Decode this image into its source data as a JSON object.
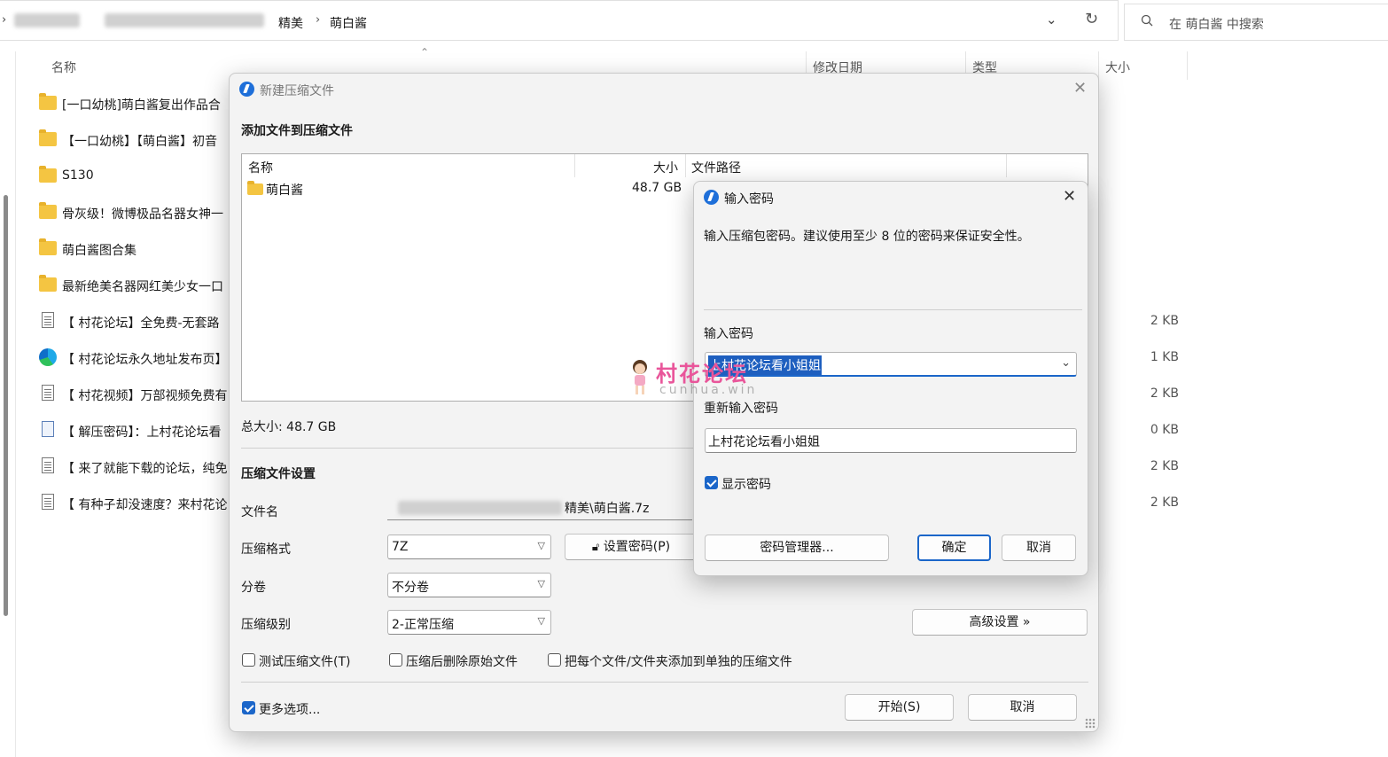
{
  "explorer": {
    "breadcrumb": [
      "精美",
      "萌白酱"
    ],
    "search_placeholder": "在 萌白酱 中搜索",
    "columns": {
      "name": "名称",
      "date": "修改日期",
      "type": "类型",
      "size": "大小"
    },
    "files": [
      {
        "icon": "folder",
        "name": "[一口幼桃]萌白酱复出作品合",
        "size": ""
      },
      {
        "icon": "folder",
        "name": "【一口幼桃】【萌白酱】初音",
        "size": ""
      },
      {
        "icon": "folder",
        "name": "S130",
        "size": ""
      },
      {
        "icon": "folder",
        "name": "骨灰级！微博极品名器女神一",
        "size": ""
      },
      {
        "icon": "folder",
        "name": "萌白酱图合集",
        "size": ""
      },
      {
        "icon": "folder",
        "name": "最新绝美名器网红美少女一口",
        "size": ""
      },
      {
        "icon": "document",
        "name": "【 村花论坛】全免费-无套路",
        "size": "2 KB"
      },
      {
        "icon": "edge",
        "name": "【 村花论坛永久地址发布页】",
        "size": "1 KB"
      },
      {
        "icon": "document",
        "name": "【 村花视频】万部视频免费有",
        "size": "2 KB"
      },
      {
        "icon": "shortcut",
        "name": "【 解压密码】：上村花论坛看",
        "size": "0 KB"
      },
      {
        "icon": "document",
        "name": "【 来了就能下载的论坛，纯免",
        "size": "2 KB"
      },
      {
        "icon": "document",
        "name": "【 有种子却没速度？来村花论",
        "size": "2 KB"
      }
    ]
  },
  "archive_dialog": {
    "title": "新建压缩文件",
    "add_section": "添加文件到压缩文件",
    "list_headers": {
      "name": "名称",
      "size": "大小",
      "path": "文件路径"
    },
    "list_items": [
      {
        "name": "萌白酱",
        "size": "48.7 GB"
      }
    ],
    "total": "总大小: 48.7 GB",
    "settings_section": "压缩文件设置",
    "filename_label": "文件名",
    "filename_value": "精美\\萌白酱.7z",
    "format_label": "压缩格式",
    "format_value": "7Z",
    "set_password_button": "设置密码(P)",
    "split_label": "分卷",
    "split_value": "不分卷",
    "level_label": "压缩级别",
    "level_value": "2-正常压缩",
    "advanced_button": "高级设置 »",
    "test_archive": "测试压缩文件(T)",
    "delete_after": "压缩后删除原始文件",
    "each_separate": "把每个文件/文件夹添加到单独的压缩文件",
    "more_options": "更多选项...",
    "start_button": "开始(S)",
    "cancel_button": "取消"
  },
  "password_dialog": {
    "title": "输入密码",
    "description": "输入压缩包密码。建议使用至少 8 位的密码来保证安全性。",
    "password_label": "输入密码",
    "password_value": "上村花论坛看小姐姐",
    "reenter_label": "重新输入密码",
    "reenter_value": "上村花论坛看小姐姐",
    "show_password": "显示密码",
    "manager_button": "密码管理器...",
    "ok_button": "确定",
    "cancel_button": "取消"
  },
  "watermark": {
    "text": "村花论坛",
    "sub": "cunhua.win"
  },
  "colors": {
    "accent": "#1b66c9",
    "folder": "#f4c542",
    "watermark": "#e9559a"
  }
}
